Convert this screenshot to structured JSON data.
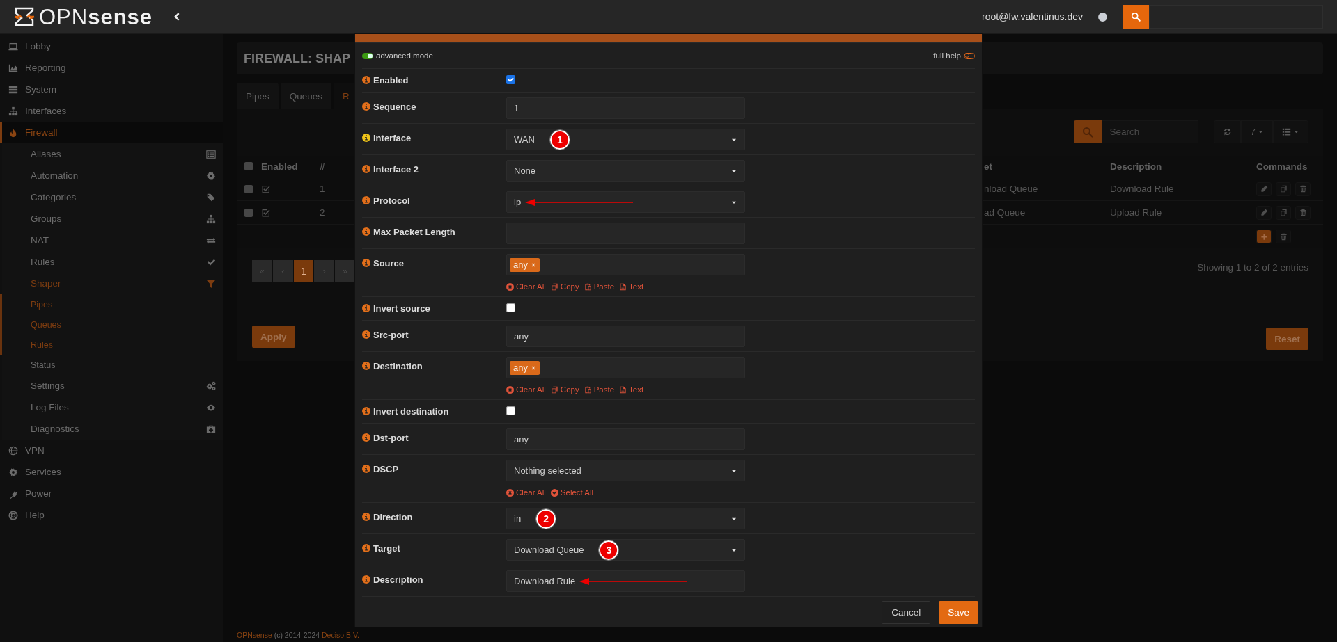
{
  "topbar": {
    "brand": "OPN**sense**",
    "user": "root@fw.valentinus.dev"
  },
  "sidebar": {
    "items": [
      {
        "label": "Lobby",
        "selected": false
      },
      {
        "label": "Reporting",
        "selected": false
      },
      {
        "label": "System",
        "selected": false
      },
      {
        "label": "Interfaces",
        "selected": false
      },
      {
        "label": "Firewall",
        "selected": true,
        "children": [
          {
            "label": "Aliases",
            "selected": false
          },
          {
            "label": "Automation",
            "selected": false
          },
          {
            "label": "Categories",
            "selected": false
          },
          {
            "label": "Groups",
            "selected": false
          },
          {
            "label": "NAT",
            "selected": false
          },
          {
            "label": "Rules",
            "selected": false
          },
          {
            "label": "Shaper",
            "selected": true,
            "children": [
              {
                "label": "Pipes",
                "selected": true
              },
              {
                "label": "Queues",
                "selected": true
              },
              {
                "label": "Rules",
                "selected": true
              },
              {
                "label": "Status",
                "selected": false
              }
            ]
          },
          {
            "label": "Settings",
            "selected": false
          },
          {
            "label": "Log Files",
            "selected": false
          },
          {
            "label": "Diagnostics",
            "selected": false
          }
        ]
      },
      {
        "label": "VPN",
        "selected": false
      },
      {
        "label": "Services",
        "selected": false
      },
      {
        "label": "Power",
        "selected": false
      },
      {
        "label": "Help",
        "selected": false
      }
    ]
  },
  "page": {
    "title": "FIREWALL: SHAP",
    "tabs": [
      {
        "label": "Pipes",
        "selected": false
      },
      {
        "label": "Queues",
        "selected": false
      },
      {
        "label": "R",
        "selected": true
      }
    ],
    "grid": {
      "search": {
        "placeholder": "Search"
      },
      "page_size": "7",
      "all_selected": false,
      "columns": [
        "Enabled",
        "#",
        "et",
        "Description",
        "Commands"
      ],
      "rows": [
        {
          "selected": false,
          "enabled": true,
          "number": "1",
          "target": "nload Queue",
          "description": "Download Rule"
        },
        {
          "selected": false,
          "enabled": true,
          "number": "2",
          "target": "ad Queue",
          "description": "Upload Rule"
        }
      ],
      "pagination": [
        {
          "label": "«",
          "selected": false
        },
        {
          "label": "‹",
          "selected": false
        },
        {
          "label": "1",
          "selected": true
        },
        {
          "label": "›",
          "selected": false
        },
        {
          "label": "»",
          "selected": false
        }
      ],
      "info": "Showing 1 to 2 of 2 entries"
    },
    "buttons": [
      "Apply",
      "Reset"
    ]
  },
  "modal": {
    "advanced_mode": {
      "label": "advanced mode",
      "on": true
    },
    "full_help": {
      "label": "full help",
      "on": false
    },
    "fields": [
      {
        "label": "Enabled",
        "kind": "checkbox",
        "checked": true,
        "help_active": false
      },
      {
        "label": "Sequence",
        "kind": "text",
        "value": "1",
        "help_active": false
      },
      {
        "label": "Interface",
        "kind": "select",
        "value": "WAN",
        "help_active": true,
        "annotation": {
          "kind": "badge",
          "text": "1"
        }
      },
      {
        "label": "Interface 2",
        "kind": "select",
        "value": "None",
        "help_active": false
      },
      {
        "label": "Protocol",
        "kind": "select",
        "value": "ip",
        "help_active": false,
        "annotation": {
          "kind": "arrow"
        }
      },
      {
        "label": "Max Packet Length",
        "kind": "text",
        "help_active": false
      },
      {
        "label": "Source",
        "kind": "tags",
        "tags": [
          "any"
        ],
        "help_active": false,
        "actions": [
          {
            "label": "Clear All",
            "kind": "clear"
          },
          {
            "label": "Copy",
            "kind": "copy"
          },
          {
            "label": "Paste",
            "kind": "paste"
          },
          {
            "label": "Text",
            "kind": "text"
          }
        ]
      },
      {
        "label": "Invert source",
        "kind": "checkbox",
        "checked": false,
        "help_active": false
      },
      {
        "label": "Src-port",
        "kind": "text",
        "value": "any",
        "help_active": false
      },
      {
        "label": "Destination",
        "kind": "tags",
        "tags": [
          "any"
        ],
        "help_active": false,
        "actions": [
          {
            "label": "Clear All",
            "kind": "clear"
          },
          {
            "label": "Copy",
            "kind": "copy"
          },
          {
            "label": "Paste",
            "kind": "paste"
          },
          {
            "label": "Text",
            "kind": "text"
          }
        ]
      },
      {
        "label": "Invert destination",
        "kind": "checkbox",
        "checked": false,
        "help_active": false
      },
      {
        "label": "Dst-port",
        "kind": "text",
        "value": "any",
        "help_active": false
      },
      {
        "label": "DSCP",
        "kind": "select",
        "value": "Nothing selected",
        "help_active": false,
        "actions": [
          {
            "label": "Clear All",
            "kind": "clear"
          },
          {
            "label": "Select All",
            "kind": "select"
          }
        ]
      },
      {
        "label": "Direction",
        "kind": "select",
        "value": "in",
        "help_active": false,
        "annotation": {
          "kind": "badge",
          "text": "2"
        }
      },
      {
        "label": "Target",
        "kind": "select",
        "value": "Download Queue",
        "help_active": false,
        "annotation": {
          "kind": "badge",
          "text": "3"
        }
      },
      {
        "label": "Description",
        "kind": "text",
        "value": "Download Rule",
        "help_active": false,
        "annotation": {
          "kind": "arrow"
        }
      }
    ],
    "buttons": [
      {
        "label": "Cancel",
        "kind": "default"
      },
      {
        "label": "Save",
        "kind": "primary"
      }
    ]
  },
  "footer": {
    "link_1": "OPNsense",
    "text": "(c) 2014-2024",
    "link_2": "Deciso B.V."
  }
}
